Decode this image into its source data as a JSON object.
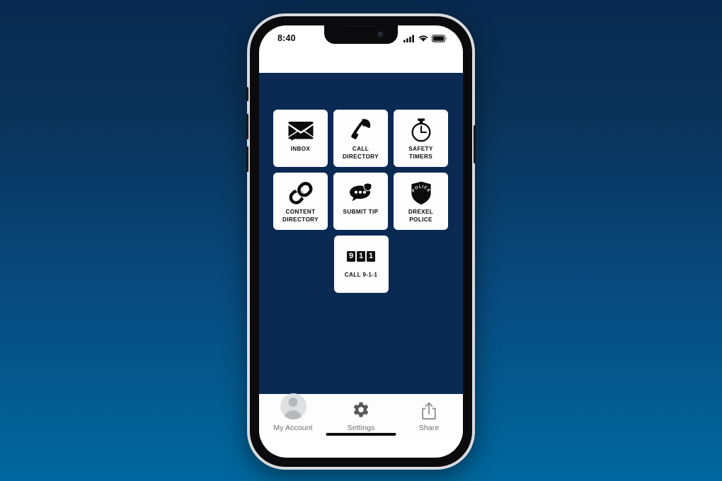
{
  "background": {
    "gradient_top": "#092a4f",
    "gradient_bottom": "#00689e"
  },
  "device": {
    "frame_color": "#0b0b0d",
    "screen_bg": "#ffffff"
  },
  "status_bar": {
    "time": "8:40",
    "icons": [
      "cellular-signal-icon",
      "wifi-icon",
      "battery-icon"
    ]
  },
  "app": {
    "background_color": "#0a2a54",
    "tile_background": "#fefefe",
    "tiles": [
      {
        "id": "inbox",
        "label": "INBOX",
        "icon": "envelope-message-icon"
      },
      {
        "id": "call-directory",
        "label": "CALL\nDIRECTORY",
        "icon": "phone-handset-icon"
      },
      {
        "id": "safety-timers",
        "label": "SAFETY\nTIMERS",
        "icon": "stopwatch-icon"
      },
      {
        "id": "content-directory",
        "label": "CONTENT\nDIRECTORY",
        "icon": "chain-link-icon"
      },
      {
        "id": "submit-tip",
        "label": "SUBMIT TIP",
        "icon": "chat-bubble-shield-icon"
      },
      {
        "id": "drexel-police",
        "label": "DREXEL\nPOLICE",
        "icon": "police-shield-icon"
      }
    ],
    "emergency_tile": {
      "id": "call-911",
      "label": "CALL 9-1-1",
      "icon": "911-digits-icon",
      "digits": [
        "9",
        "1",
        "1"
      ]
    }
  },
  "tab_bar": {
    "background_color": "#fdfdfd",
    "items": [
      {
        "id": "my-account",
        "label": "My Account",
        "icon": "avatar-icon"
      },
      {
        "id": "settings",
        "label": "Settings",
        "icon": "gear-icon"
      },
      {
        "id": "share",
        "label": "Share",
        "icon": "share-upload-icon"
      }
    ]
  }
}
